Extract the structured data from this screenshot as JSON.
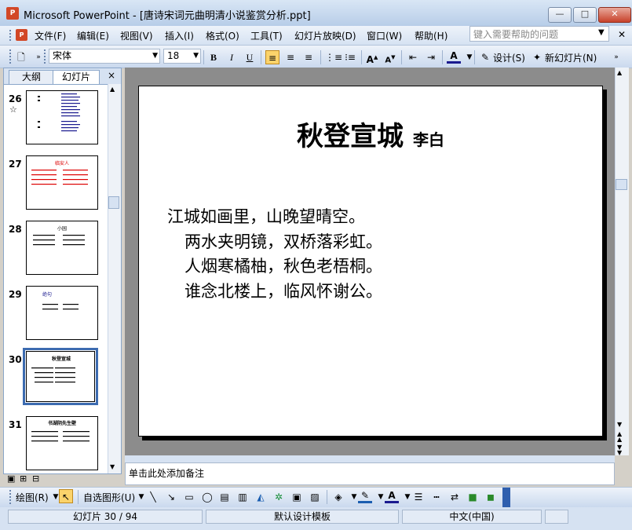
{
  "window": {
    "title": "Microsoft PowerPoint - [唐诗宋词元曲明清小说鉴赏分析.ppt]",
    "app_icon_label": "P",
    "minimize": "—",
    "maximize": "□",
    "close": "✕"
  },
  "menu": {
    "items": [
      "文件(F)",
      "编辑(E)",
      "视图(V)",
      "插入(I)",
      "格式(O)",
      "工具(T)",
      "幻灯片放映(D)",
      "窗口(W)",
      "帮助(H)"
    ],
    "help_placeholder": "键入需要帮助的问题"
  },
  "format_toolbar": {
    "font": "宋体",
    "size": "18",
    "bold": "B",
    "italic": "I",
    "underline": "U",
    "design_label": "设计(S)",
    "new_slide_label": "新幻灯片(N)"
  },
  "left_pane": {
    "tab_outline": "大纲",
    "tab_slides": "幻灯片",
    "close": "×",
    "thumbnails": [
      {
        "num": "26",
        "star": "☆"
      },
      {
        "num": "27",
        "title": "临安人"
      },
      {
        "num": "28",
        "title": "小园"
      },
      {
        "num": "29",
        "title": "绝句"
      },
      {
        "num": "30",
        "title": "秋登宣城"
      },
      {
        "num": "31",
        "title": "书湖阴先生壁"
      }
    ]
  },
  "slide": {
    "title": "秋登宣城",
    "author": "李白",
    "lines": [
      "江城如画里，山晚望晴空。",
      "两水夹明镜，双桥落彩虹。",
      "人烟寒橘柚，秋色老梧桐。",
      "谁念北楼上，临风怀谢公。"
    ]
  },
  "notes_placeholder": "单击此处添加备注",
  "draw_toolbar": {
    "draw_label": "绘图(R)",
    "autoshapes_label": "自选图形(U)"
  },
  "status": {
    "slide_pos": "幻灯片 30 / 94",
    "template": "默认设计模板",
    "language": "中文(中国)"
  }
}
